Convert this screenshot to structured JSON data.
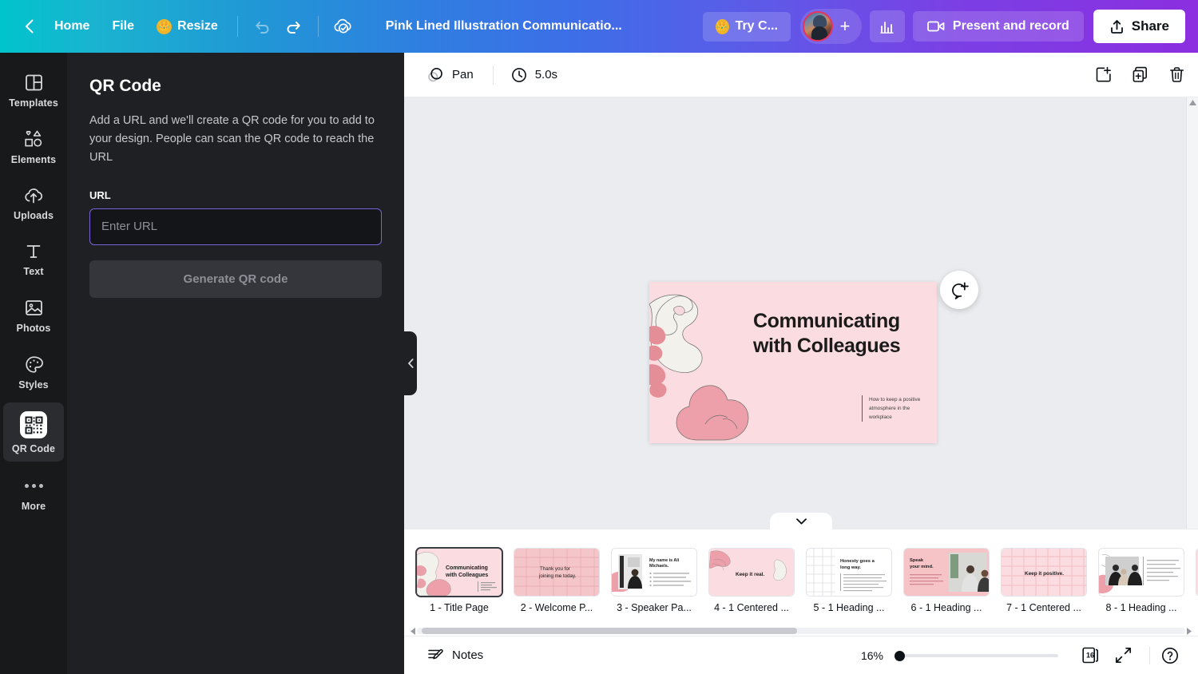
{
  "topbar": {
    "back_icon": "chevron-left-icon",
    "home_label": "Home",
    "file_label": "File",
    "resize_label": "Resize",
    "crown_icon": "crown-icon",
    "undo_icon": "undo-icon",
    "redo_icon": "redo-icon",
    "cloud_saved_icon": "cloud-check-icon",
    "design_title": "Pink Lined Illustration Communicatio...",
    "try_label": "Try C...",
    "avatar_icon": "user-avatar",
    "add_collaborator_icon": "plus-icon",
    "insights_icon": "bar-chart-icon",
    "present_label": "Present and record",
    "present_icon": "video-camera-icon",
    "share_label": "Share",
    "share_icon": "share-upload-icon"
  },
  "rail": {
    "items": [
      {
        "label": "Templates",
        "icon": "templates-grid-icon",
        "active": false
      },
      {
        "label": "Elements",
        "icon": "shapes-icon",
        "active": false
      },
      {
        "label": "Uploads",
        "icon": "cloud-upload-icon",
        "active": false
      },
      {
        "label": "Text",
        "icon": "text-t-icon",
        "active": false
      },
      {
        "label": "Photos",
        "icon": "photo-icon",
        "active": false
      },
      {
        "label": "Styles",
        "icon": "palette-icon",
        "active": false
      },
      {
        "label": "QR Code",
        "icon": "qr-code-icon",
        "active": true
      },
      {
        "label": "More",
        "icon": "more-dots-icon",
        "active": false
      }
    ]
  },
  "panel": {
    "title": "QR Code",
    "description": "Add a URL and we'll create a QR code for you to add to your design. People can scan the QR code to reach the URL",
    "url_label": "URL",
    "url_value": "",
    "url_placeholder": "Enter URL",
    "generate_label": "Generate QR code",
    "collapse_icon": "chevron-left-icon"
  },
  "canvas_toolbar": {
    "pan_label": "Pan",
    "pan_icon": "pan-hand-icon",
    "duration_label": "5.0s",
    "timer_icon": "clock-icon",
    "add_page_icon": "add-page-icon",
    "duplicate_page_icon": "duplicate-page-icon",
    "delete_page_icon": "trash-icon"
  },
  "slide": {
    "title_line1": "Communicating",
    "title_line2": "with Colleagues",
    "subtitle": "How to keep a positive atmosphere in the workplace",
    "background_color": "#fbdde1",
    "accent_color": "#e99aa4",
    "comment_icon": "add-comment-icon"
  },
  "thumbnails": {
    "collapse_icon": "chevron-down-icon",
    "left_arrow_icon": "chevron-left-icon",
    "right_arrow_icon": "chevron-right-icon",
    "items": [
      {
        "label": "1 - Title Page",
        "active": true,
        "preview_text": "Communicating with Colleagues",
        "kind": "title"
      },
      {
        "label": "2 - Welcome P...",
        "active": false,
        "preview_text": "Thank you for joining me today.",
        "kind": "grid-quote"
      },
      {
        "label": "3 - Speaker Pa...",
        "active": false,
        "preview_text": "My name is Ali Michaels.",
        "kind": "photo-left"
      },
      {
        "label": "4 - 1 Centered ...",
        "active": false,
        "preview_text": "Keep it real.",
        "kind": "pink-quote"
      },
      {
        "label": "5 - 1 Heading ...",
        "active": false,
        "preview_text": "Honesty goes a long way.",
        "kind": "grid-body"
      },
      {
        "label": "6 - 1 Heading ...",
        "active": false,
        "preview_text": "Speak your mind.",
        "kind": "photo-right"
      },
      {
        "label": "7 - 1 Centered ...",
        "active": false,
        "preview_text": "Keep it positive.",
        "kind": "grid-quote"
      },
      {
        "label": "8 - 1 Heading ...",
        "active": false,
        "preview_text": "",
        "kind": "photo-text"
      },
      {
        "label": "",
        "active": false,
        "preview_text": "",
        "kind": "partial"
      }
    ]
  },
  "bottombar": {
    "notes_label": "Notes",
    "notes_icon": "notes-icon",
    "zoom_label": "16%",
    "zoom_value": 16,
    "page_count": "16",
    "grid_view_icon": "grid-view-icon",
    "fullscreen_icon": "expand-icon",
    "help_icon": "help-circle-icon"
  }
}
